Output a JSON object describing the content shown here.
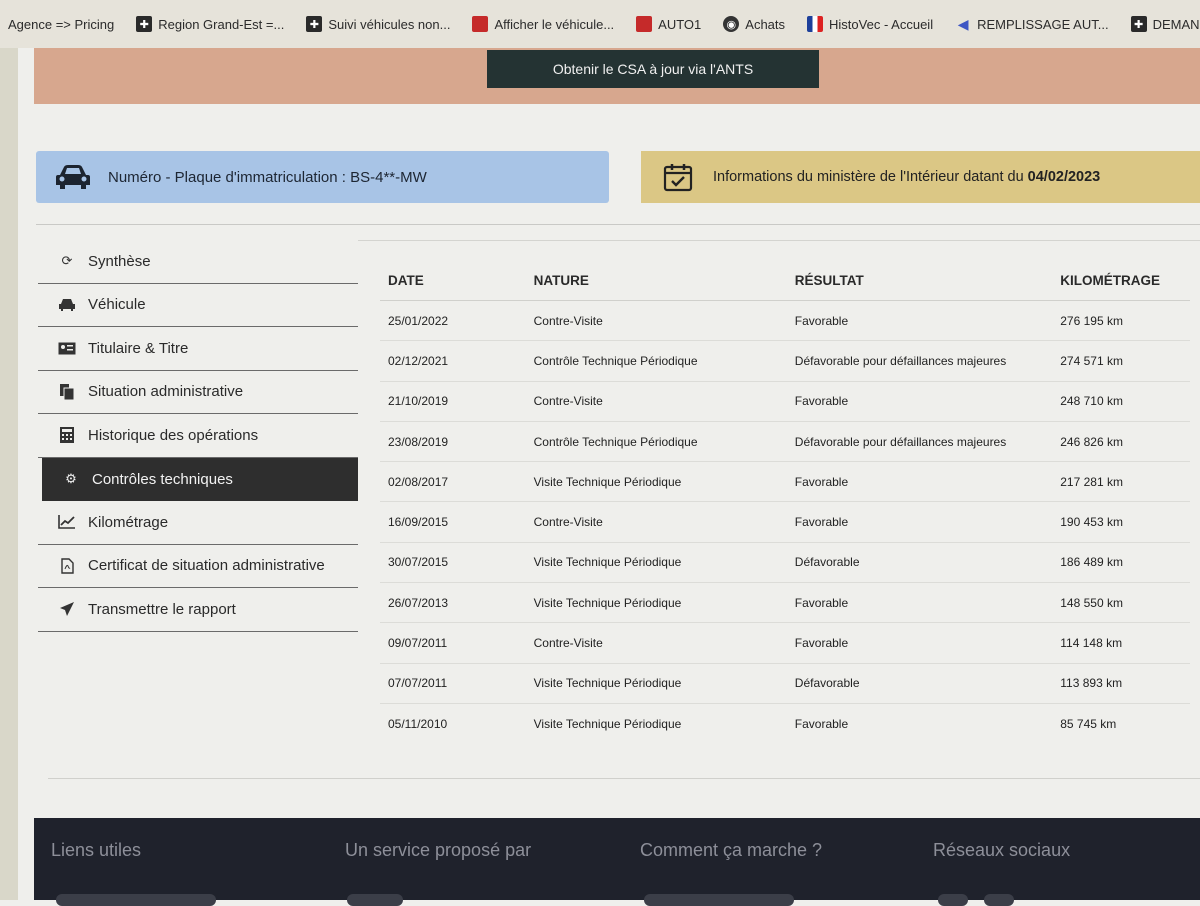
{
  "bookmarks": [
    {
      "label": "Agence => Pricing",
      "icon": "none"
    },
    {
      "label": "Region Grand-Est =...",
      "icon": "cross-icon"
    },
    {
      "label": "Suivi véhicules non...",
      "icon": "cross-icon"
    },
    {
      "label": "Afficher le véhicule...",
      "icon": "red-square-icon"
    },
    {
      "label": "AUTO1",
      "icon": "red-square-icon"
    },
    {
      "label": "Achats",
      "icon": "circle-icon"
    },
    {
      "label": "HistoVec - Accueil",
      "icon": "flag-icon"
    },
    {
      "label": "REMPLISSAGE AUT...",
      "icon": "arrow-icon"
    },
    {
      "label": "DEMANDE DE CON...",
      "icon": "cross-icon"
    }
  ],
  "csa_button": "Obtenir le CSA à jour via l'ANTS",
  "plate": {
    "label": "Numéro - Plaque d'immatriculation : BS-4**-MW"
  },
  "info": {
    "text": "Informations du ministère de l'Intérieur datant du",
    "date": "04/02/2023"
  },
  "sidebar": {
    "items": [
      {
        "label": "Synthèse",
        "icon": "refresh-icon"
      },
      {
        "label": "Véhicule",
        "icon": "car-icon"
      },
      {
        "label": "Titulaire & Titre",
        "icon": "id-card-icon"
      },
      {
        "label": "Situation administrative",
        "icon": "document-icon"
      },
      {
        "label": "Historique des opérations",
        "icon": "calculator-icon"
      },
      {
        "label": "Contrôles techniques",
        "icon": "gears-icon"
      },
      {
        "label": "Kilométrage",
        "icon": "chart-line-icon"
      },
      {
        "label": "Certificat de situation administrative",
        "icon": "pdf-icon"
      },
      {
        "label": "Transmettre le rapport",
        "icon": "send-icon"
      }
    ]
  },
  "table": {
    "headers": [
      "DATE",
      "NATURE",
      "RÉSULTAT",
      "KILOMÉTRAGE"
    ],
    "rows": [
      [
        "25/01/2022",
        "Contre-Visite",
        "Favorable",
        "276 195 km"
      ],
      [
        "02/12/2021",
        "Contrôle Technique Périodique",
        "Défavorable pour défaillances majeures",
        "274 571 km"
      ],
      [
        "21/10/2019",
        "Contre-Visite",
        "Favorable",
        "248 710 km"
      ],
      [
        "23/08/2019",
        "Contrôle Technique Périodique",
        "Défavorable pour défaillances majeures",
        "246 826 km"
      ],
      [
        "02/08/2017",
        "Visite Technique Périodique",
        "Favorable",
        "217 281 km"
      ],
      [
        "16/09/2015",
        "Contre-Visite",
        "Favorable",
        "190 453 km"
      ],
      [
        "30/07/2015",
        "Visite Technique Périodique",
        "Défavorable",
        "186 489 km"
      ],
      [
        "26/07/2013",
        "Visite Technique Périodique",
        "Favorable",
        "148 550 km"
      ],
      [
        "09/07/2011",
        "Contre-Visite",
        "Favorable",
        "114 148 km"
      ],
      [
        "07/07/2011",
        "Visite Technique Périodique",
        "Défavorable",
        "113 893 km"
      ],
      [
        "05/11/2010",
        "Visite Technique Périodique",
        "Favorable",
        "85 745 km"
      ]
    ]
  },
  "footer": {
    "col1": "Liens utiles",
    "col2": "Un service proposé par",
    "col3": "Comment ça marche ?",
    "col4": "Réseaux sociaux"
  }
}
